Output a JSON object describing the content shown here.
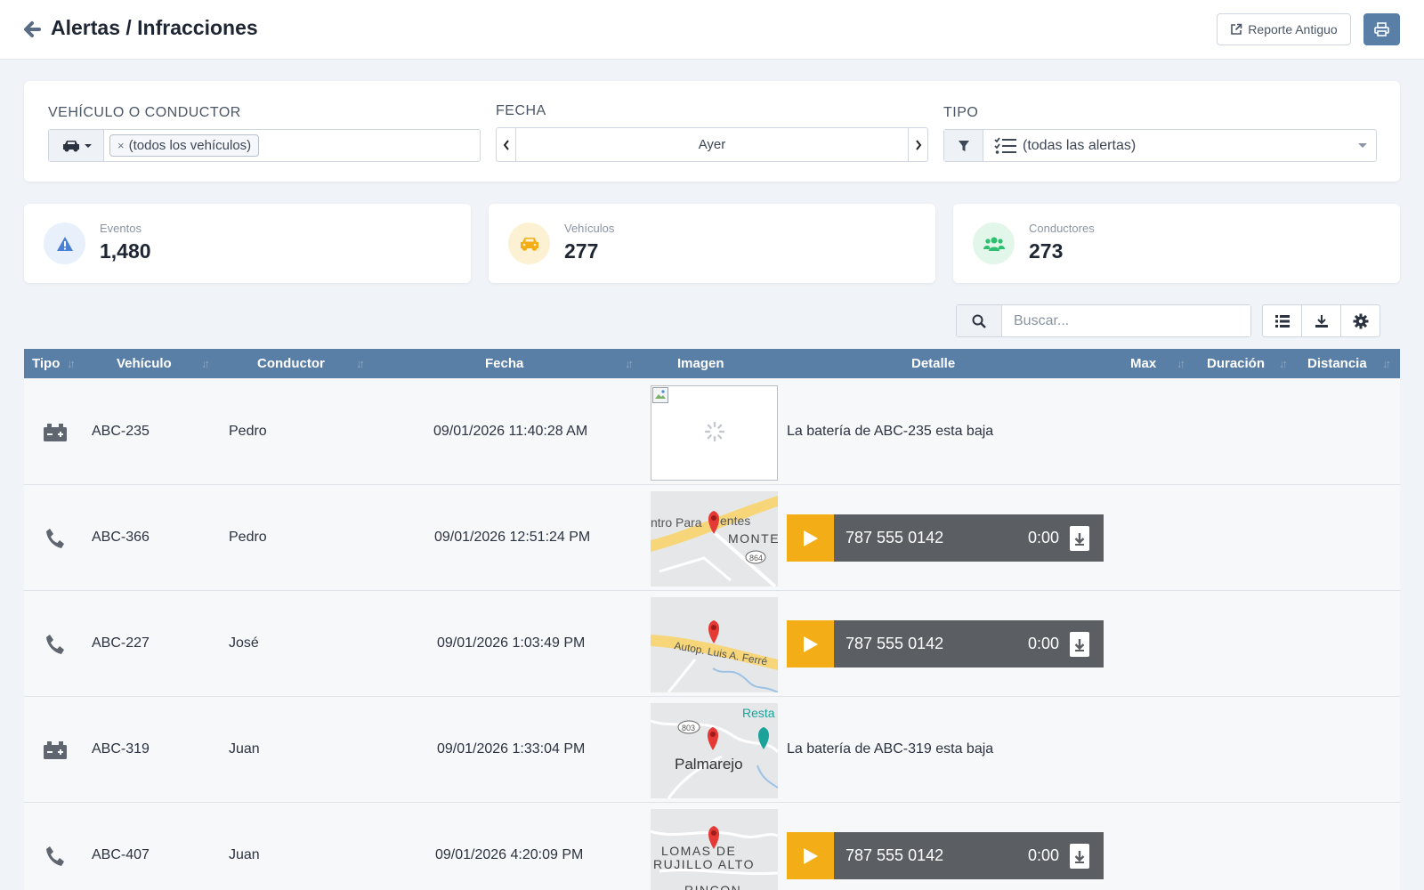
{
  "header": {
    "title": "Alertas / Infracciones",
    "old_report_label": "Reporte Antiguo"
  },
  "filters": {
    "vehicle_label": "VEHÍCULO O CONDUCTOR",
    "vehicle_tag": "(todos los vehículos)",
    "date_label": "FECHA",
    "date_value": "Ayer",
    "type_label": "TIPO",
    "type_value": "(todas las alertas)"
  },
  "stats": {
    "events": {
      "label": "Eventos",
      "value": "1,480",
      "color": "#4a7fd6"
    },
    "vehicles": {
      "label": "Vehículos",
      "value": "277",
      "color": "#f3ae17"
    },
    "drivers": {
      "label": "Conductores",
      "value": "273",
      "color": "#2fbf71"
    }
  },
  "search": {
    "placeholder": "Buscar..."
  },
  "table": {
    "columns": {
      "tipo": "Tipo",
      "vehiculo": "Vehículo",
      "conductor": "Conductor",
      "fecha": "Fecha",
      "imagen": "Imagen",
      "detalle": "Detalle",
      "max": "Max",
      "duracion": "Duración",
      "distancia": "Distancia"
    },
    "rows": [
      {
        "type_icon": "battery-icon",
        "vehicle": "ABC-235",
        "driver": "Pedro",
        "date": "09/01/2026 11:40:28 AM",
        "image": "broken-image",
        "detail": "La batería de ABC-235 esta baja"
      },
      {
        "type_icon": "phone-icon",
        "vehicle": "ABC-366",
        "driver": "Pedro",
        "date": "09/01/2026 12:51:24 PM",
        "image": "map",
        "map_labels": [
          "ntro Para",
          "entes",
          "MONTE",
          "864"
        ],
        "phone": "787 555 0142",
        "time": "0:00"
      },
      {
        "type_icon": "phone-icon",
        "vehicle": "ABC-227",
        "driver": "José",
        "date": "09/01/2026 1:03:49 PM",
        "image": "map",
        "map_labels": [
          "Autop. Luis A. Ferré"
        ],
        "phone": "787 555 0142",
        "time": "0:00"
      },
      {
        "type_icon": "battery-icon",
        "vehicle": "ABC-319",
        "driver": "Juan",
        "date": "09/01/2026 1:33:04 PM",
        "image": "map",
        "map_labels": [
          "Resta",
          "803",
          "Palmarejo"
        ],
        "detail": "La batería de ABC-319 esta baja"
      },
      {
        "type_icon": "phone-icon",
        "vehicle": "ABC-407",
        "driver": "Juan",
        "date": "09/01/2026 4:20:09 PM",
        "image": "map",
        "map_labels": [
          "LOMAS DE",
          "RUJILLO ALTO",
          "RINCON"
        ],
        "phone": "787 555 0142",
        "time": "0:00"
      }
    ]
  },
  "colors": {
    "accent": "#5a7fa6",
    "player_bg": "#5b5f63",
    "play_bg": "#f3ae17",
    "marker": "#e53935"
  }
}
